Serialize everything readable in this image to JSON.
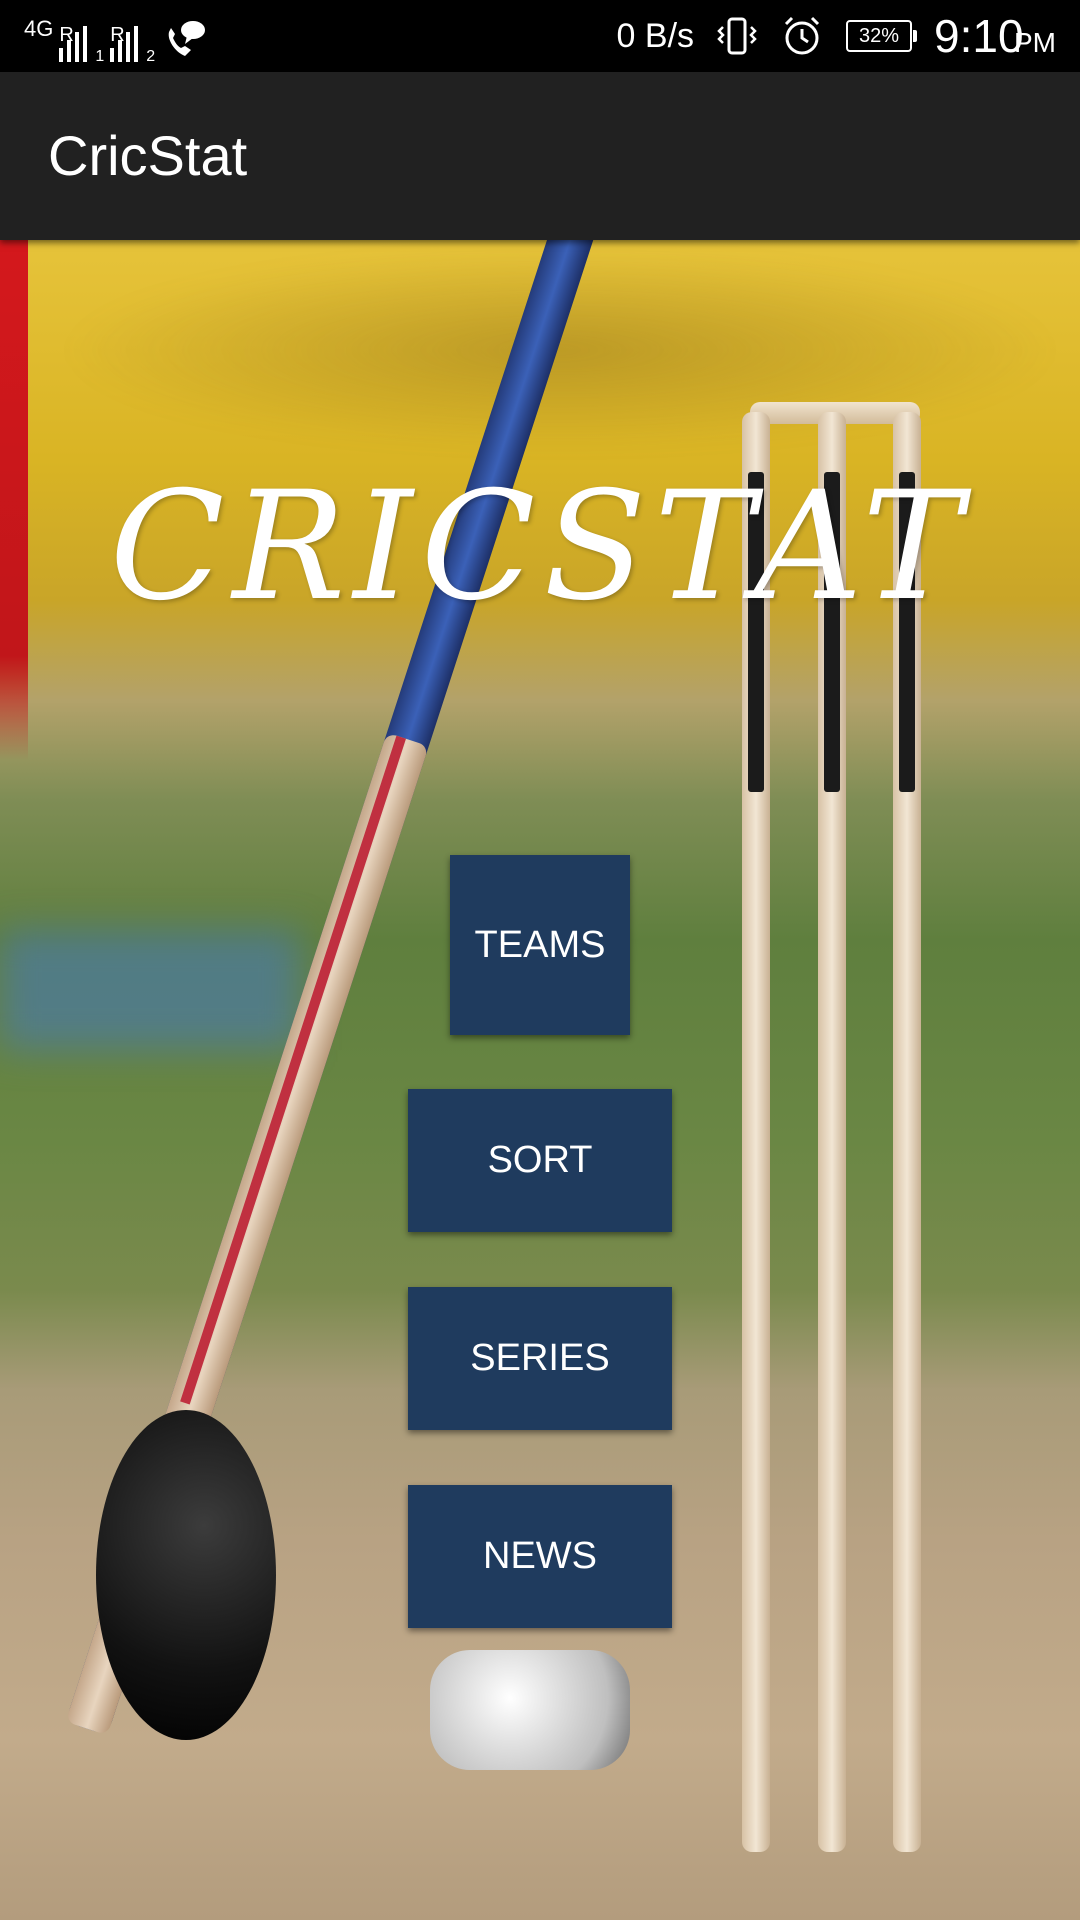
{
  "status_bar": {
    "network": "4G",
    "sim1_roaming": "R",
    "sim1_index": "1",
    "sim2_roaming": "R",
    "sim2_index": "2",
    "data_speed": "0 B/s",
    "battery": "32%",
    "time": "9:10",
    "ampm": "PM",
    "icons": [
      "signal-icon",
      "call-chat-icon",
      "vibrate-icon",
      "alarm-icon",
      "battery-icon"
    ]
  },
  "app_bar": {
    "title": "CricStat"
  },
  "hero": {
    "logo_text": "CRICSTAT"
  },
  "menu": {
    "teams": "TEAMS",
    "sort": "SORT",
    "series": "SERIES",
    "news": "NEWS"
  },
  "colors": {
    "button_bg": "#1f3b5e",
    "app_bar_bg": "#212121",
    "status_bar_bg": "#000000"
  }
}
